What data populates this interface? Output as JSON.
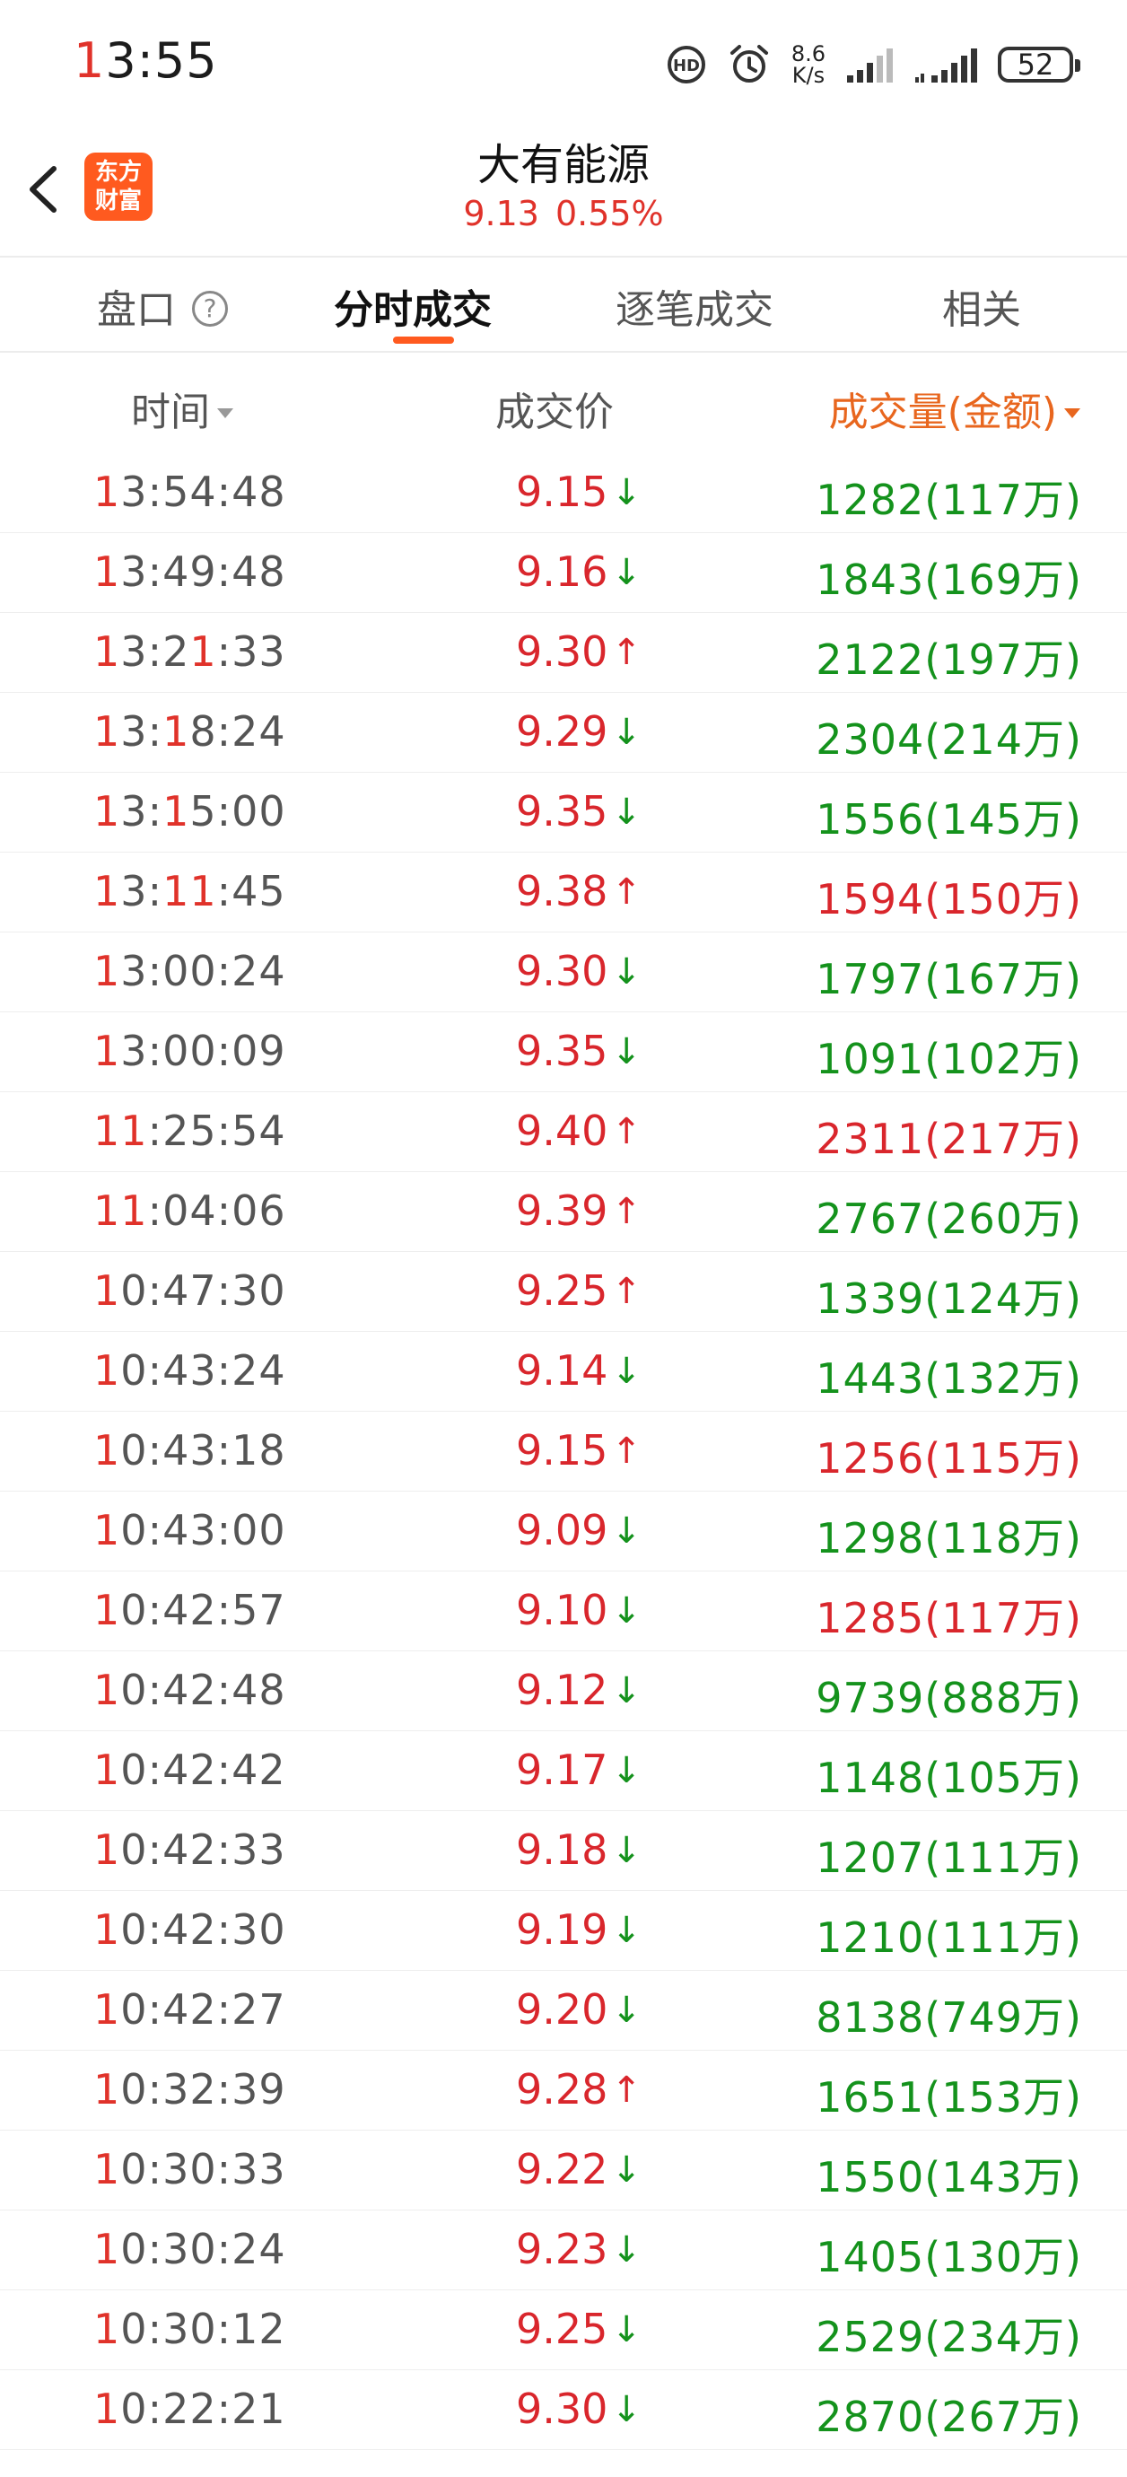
{
  "status_bar": {
    "time_lead": "1",
    "time_rest": "3:55",
    "net_speed_value": "8.6",
    "net_speed_unit": "K/s",
    "battery": "52"
  },
  "header": {
    "logo_line1": "东方",
    "logo_line2": "财富",
    "stock_name": "大有能源",
    "price": "9.13",
    "change_pct": "0.55%"
  },
  "tabs": [
    {
      "label": "盘口",
      "active": false
    },
    {
      "label": "分时成交",
      "active": true
    },
    {
      "label": "逐笔成交",
      "active": false
    },
    {
      "label": "相关",
      "active": false
    }
  ],
  "columns": {
    "time": "时间",
    "price": "成交价",
    "volume": "成交量(金额)"
  },
  "colors": {
    "up": "#d9262c",
    "down": "#14921c",
    "accent": "#ff5a1f"
  },
  "trades": [
    {
      "hh": "13",
      "rest": ":54:48",
      "price": "9.15",
      "dir": "down",
      "vol": "1282",
      "amt": "117万",
      "color": "green"
    },
    {
      "hh": "13",
      "rest": ":49:48",
      "price": "9.16",
      "dir": "down",
      "vol": "1843",
      "amt": "169万",
      "color": "green"
    },
    {
      "hh": "13",
      "rest": ":21:33",
      "price": "9.30",
      "dir": "up",
      "vol": "2122",
      "amt": "197万",
      "color": "green"
    },
    {
      "hh": "13",
      "rest": ":18:24",
      "price": "9.29",
      "dir": "down",
      "vol": "2304",
      "amt": "214万",
      "color": "green"
    },
    {
      "hh": "13",
      "rest": ":15:00",
      "price": "9.35",
      "dir": "down",
      "vol": "1556",
      "amt": "145万",
      "color": "green"
    },
    {
      "hh": "13",
      "rest": ":11:45",
      "price": "9.38",
      "dir": "up",
      "vol": "1594",
      "amt": "150万",
      "color": "red"
    },
    {
      "hh": "13",
      "rest": ":00:24",
      "price": "9.30",
      "dir": "down",
      "vol": "1797",
      "amt": "167万",
      "color": "green"
    },
    {
      "hh": "13",
      "rest": ":00:09",
      "price": "9.35",
      "dir": "down",
      "vol": "1091",
      "amt": "102万",
      "color": "green"
    },
    {
      "hh": "11",
      "rest": ":25:54",
      "price": "9.40",
      "dir": "up",
      "vol": "2311",
      "amt": "217万",
      "color": "red"
    },
    {
      "hh": "11",
      "rest": ":04:06",
      "price": "9.39",
      "dir": "up",
      "vol": "2767",
      "amt": "260万",
      "color": "green"
    },
    {
      "hh": "10",
      "rest": ":47:30",
      "price": "9.25",
      "dir": "up",
      "vol": "1339",
      "amt": "124万",
      "color": "green"
    },
    {
      "hh": "10",
      "rest": ":43:24",
      "price": "9.14",
      "dir": "down",
      "vol": "1443",
      "amt": "132万",
      "color": "green"
    },
    {
      "hh": "10",
      "rest": ":43:18",
      "price": "9.15",
      "dir": "up",
      "vol": "1256",
      "amt": "115万",
      "color": "red"
    },
    {
      "hh": "10",
      "rest": ":43:00",
      "price": "9.09",
      "dir": "down",
      "vol": "1298",
      "amt": "118万",
      "color": "green"
    },
    {
      "hh": "10",
      "rest": ":42:57",
      "price": "9.10",
      "dir": "down",
      "vol": "1285",
      "amt": "117万",
      "color": "red"
    },
    {
      "hh": "10",
      "rest": ":42:48",
      "price": "9.12",
      "dir": "down",
      "vol": "9739",
      "amt": "888万",
      "color": "green"
    },
    {
      "hh": "10",
      "rest": ":42:42",
      "price": "9.17",
      "dir": "down",
      "vol": "1148",
      "amt": "105万",
      "color": "green"
    },
    {
      "hh": "10",
      "rest": ":42:33",
      "price": "9.18",
      "dir": "down",
      "vol": "1207",
      "amt": "111万",
      "color": "green"
    },
    {
      "hh": "10",
      "rest": ":42:30",
      "price": "9.19",
      "dir": "down",
      "vol": "1210",
      "amt": "111万",
      "color": "green"
    },
    {
      "hh": "10",
      "rest": ":42:27",
      "price": "9.20",
      "dir": "down",
      "vol": "8138",
      "amt": "749万",
      "color": "green"
    },
    {
      "hh": "10",
      "rest": ":32:39",
      "price": "9.28",
      "dir": "up",
      "vol": "1651",
      "amt": "153万",
      "color": "green"
    },
    {
      "hh": "10",
      "rest": ":30:33",
      "price": "9.22",
      "dir": "down",
      "vol": "1550",
      "amt": "143万",
      "color": "green"
    },
    {
      "hh": "10",
      "rest": ":30:24",
      "price": "9.23",
      "dir": "down",
      "vol": "1405",
      "amt": "130万",
      "color": "green"
    },
    {
      "hh": "10",
      "rest": ":30:12",
      "price": "9.25",
      "dir": "down",
      "vol": "2529",
      "amt": "234万",
      "color": "green"
    },
    {
      "hh": "10",
      "rest": ":22:21",
      "price": "9.30",
      "dir": "down",
      "vol": "2870",
      "amt": "267万",
      "color": "green"
    }
  ]
}
